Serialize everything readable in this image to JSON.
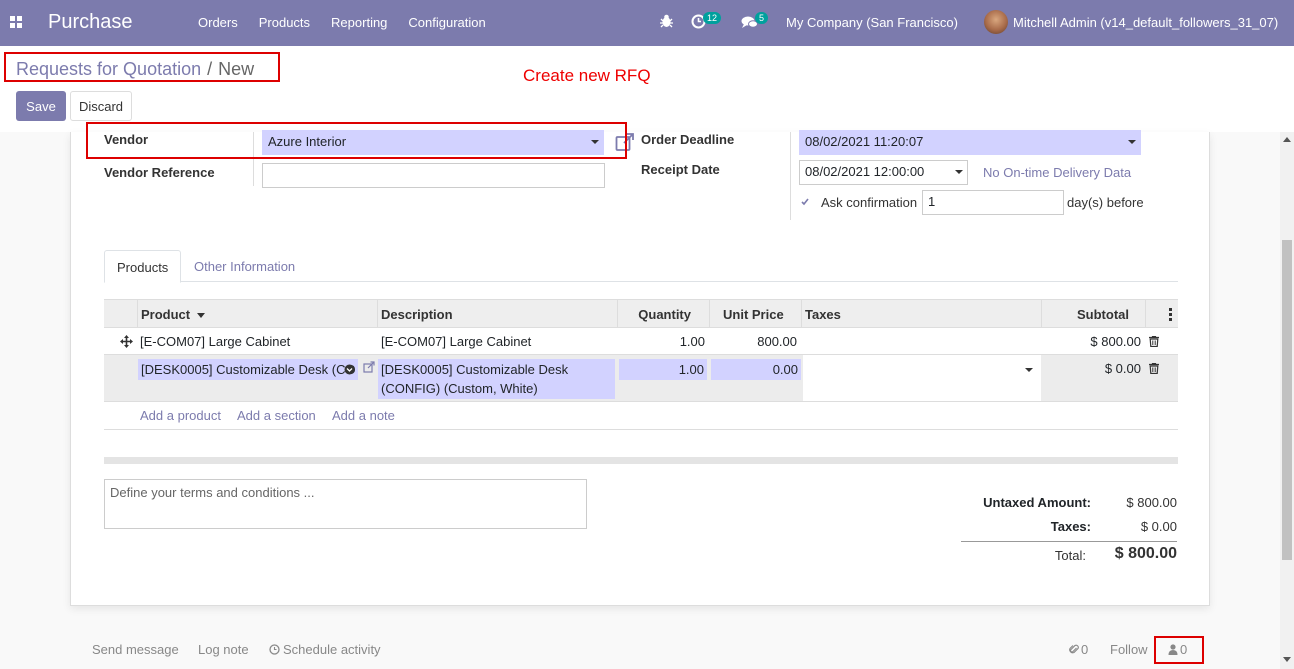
{
  "topbar": {
    "app_name": "Purchase",
    "menu": [
      "Orders",
      "Products",
      "Reporting",
      "Configuration"
    ],
    "activity_count": "12",
    "message_count": "5",
    "company": "My Company (San Francisco)",
    "user": "Mitchell Admin (v14_default_followers_31_07)"
  },
  "breadcrumb": {
    "parent": "Requests for Quotation",
    "separator": "/",
    "current": "New"
  },
  "annotation": "Create new RFQ",
  "buttons": {
    "save": "Save",
    "discard": "Discard"
  },
  "form": {
    "vendor_label": "Vendor",
    "vendor_value": "Azure Interior",
    "vendor_ref_label": "Vendor Reference",
    "vendor_ref_value": "",
    "order_deadline_label": "Order Deadline",
    "order_deadline_value": "08/02/2021 11:20:07",
    "receipt_date_label": "Receipt Date",
    "receipt_date_value": "08/02/2021 12:00:00",
    "no_ontime_label": "No On-time Delivery Data",
    "ask_confirmation_label": "Ask confirmation",
    "ask_confirmation_days": "1",
    "days_before_label": "day(s) before"
  },
  "tabs": {
    "products": "Products",
    "other": "Other Information"
  },
  "table": {
    "headers": {
      "product": "Product",
      "description": "Description",
      "quantity": "Quantity",
      "unit_price": "Unit Price",
      "taxes": "Taxes",
      "subtotal": "Subtotal"
    },
    "rows": [
      {
        "product": "[E-COM07] Large Cabinet",
        "description": "[E-COM07] Large Cabinet",
        "quantity": "1.00",
        "unit_price": "800.00",
        "taxes": "",
        "subtotal": "$ 800.00"
      },
      {
        "product": "[DESK0005] Customizable Desk (CO",
        "description": "[DESK0005] Customizable Desk (CONFIG) (Custom, White)",
        "description_line1": "[DESK0005] Customizable Desk",
        "description_line2": "(CONFIG) (Custom, White)",
        "quantity": "1.00",
        "unit_price": "0.00",
        "taxes": "",
        "subtotal": "$ 0.00"
      }
    ],
    "add_product": "Add a product",
    "add_section": "Add a section",
    "add_note": "Add a note"
  },
  "notes_placeholder": "Define your terms and conditions ...",
  "totals": {
    "untaxed_label": "Untaxed Amount:",
    "untaxed_value": "$ 800.00",
    "taxes_label": "Taxes:",
    "taxes_value": "$ 0.00",
    "total_label": "Total:",
    "total_value": "$ 800.00"
  },
  "chatter": {
    "send_message": "Send message",
    "log_note": "Log note",
    "schedule_activity": "Schedule activity",
    "attachments": "0",
    "follow": "Follow",
    "followers": "0"
  }
}
